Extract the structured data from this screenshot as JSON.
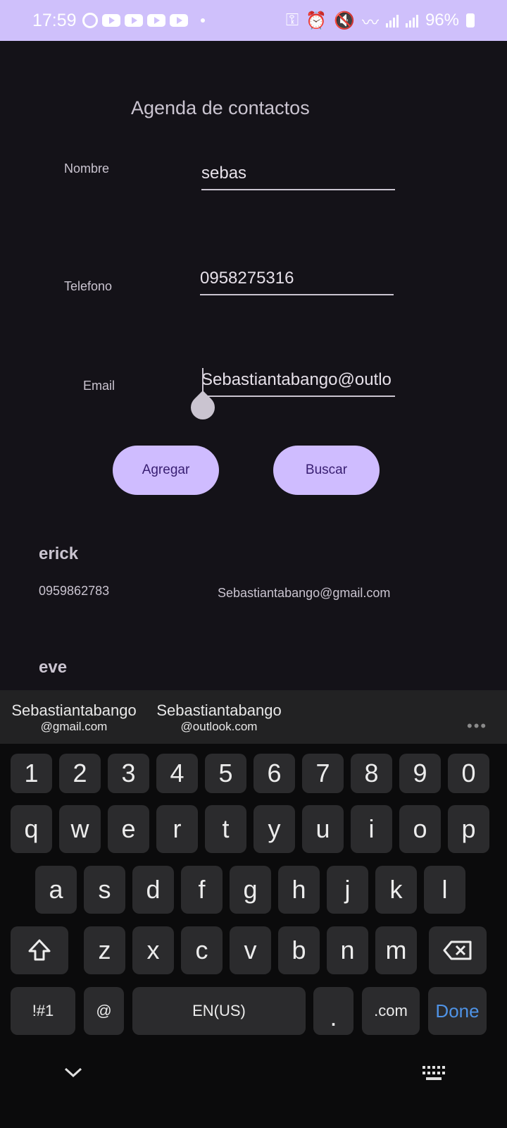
{
  "status": {
    "time": "17:59",
    "battery": "96%"
  },
  "app": {
    "title": "Agenda de contactos",
    "labels": {
      "nombre": "Nombre",
      "telefono": "Telefono",
      "email": "Email"
    },
    "fields": {
      "nombre": "sebas",
      "telefono": "0958275316",
      "email": "Sebastiantabango@outlo"
    },
    "buttons": {
      "add": "Agregar",
      "search": "Buscar"
    },
    "contacts": [
      {
        "name": "erick",
        "phone": "0959862783",
        "email": "Sebastiantabango@gmail.com"
      },
      {
        "name": "eve"
      }
    ]
  },
  "keyboard": {
    "suggestions": [
      {
        "line1": "Sebastiantabango",
        "line2": "@gmail.com"
      },
      {
        "line1": "Sebastiantabango",
        "line2": "@outlook.com"
      }
    ],
    "row_numbers": [
      "1",
      "2",
      "3",
      "4",
      "5",
      "6",
      "7",
      "8",
      "9",
      "0"
    ],
    "row_top": [
      "q",
      "w",
      "e",
      "r",
      "t",
      "y",
      "u",
      "i",
      "o",
      "p"
    ],
    "row_mid": [
      "a",
      "s",
      "d",
      "f",
      "g",
      "h",
      "j",
      "k",
      "l"
    ],
    "row_bottom": [
      "z",
      "x",
      "c",
      "v",
      "b",
      "n",
      "m"
    ],
    "symbols": "!#1",
    "at": "@",
    "space": "EN(US)",
    "period": ".",
    "dotcom": ".com",
    "done": "Done"
  }
}
